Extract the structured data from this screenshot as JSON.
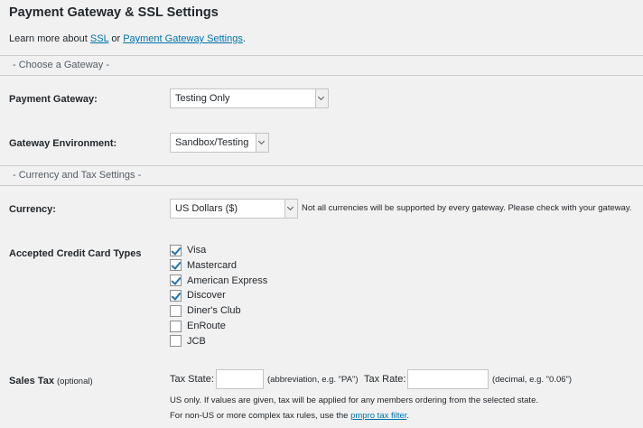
{
  "title": "Payment Gateway & SSL Settings",
  "intro": {
    "prefix": "Learn more about ",
    "ssl_link": "SSL",
    "middle": " or ",
    "gateway_link": "Payment Gateway Settings",
    "suffix": "."
  },
  "sections": {
    "gateway": "- Choose a Gateway -",
    "currency": "- Currency and Tax Settings -"
  },
  "fields": {
    "payment_gateway": {
      "label": "Payment Gateway:",
      "value": "Testing Only"
    },
    "gateway_environment": {
      "label": "Gateway Environment:",
      "value": "Sandbox/Testing"
    },
    "currency": {
      "label": "Currency:",
      "value": "US Dollars ($)",
      "note": "Not all currencies will be supported by every gateway. Please check with your gateway."
    }
  },
  "credit_cards": {
    "label": "Accepted Credit Card Types",
    "items": [
      {
        "label": "Visa",
        "checked": true
      },
      {
        "label": "Mastercard",
        "checked": true
      },
      {
        "label": "American Express",
        "checked": true
      },
      {
        "label": "Discover",
        "checked": true
      },
      {
        "label": "Diner's Club",
        "checked": false
      },
      {
        "label": "EnRoute",
        "checked": false
      },
      {
        "label": "JCB",
        "checked": false
      }
    ]
  },
  "sales_tax": {
    "label": "Sales Tax",
    "optional": "(optional)",
    "state_label": "Tax State:",
    "state_value": "",
    "state_hint": "(abbreviation, e.g. \"PA\")",
    "rate_label": "Tax Rate:",
    "rate_value": "",
    "rate_hint": "(decimal, e.g. \"0.06\")",
    "note1": "US only. If values are given, tax will be applied for any members ordering from the selected state.",
    "note2_prefix": "For non-US or more complex tax rules, use the ",
    "note2_link": "pmpro tax filter",
    "note2_suffix": "."
  }
}
